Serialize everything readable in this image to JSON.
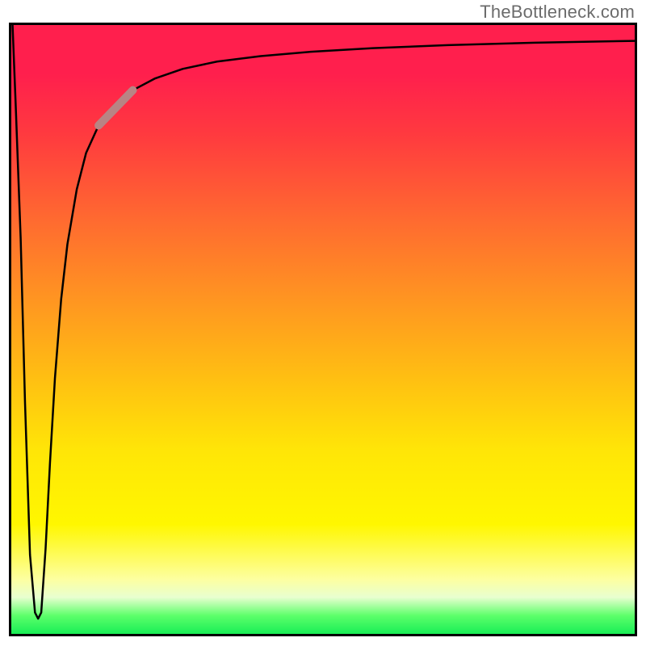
{
  "attribution": "TheBottleneck.com",
  "colors": {
    "border": "#000000",
    "curve": "#000000",
    "highlight": "#b88484",
    "gradient_top": "#ff1f4d",
    "gradient_bottom": "#19ee56"
  },
  "chart_data": {
    "type": "line",
    "title": "",
    "xlabel": "",
    "ylabel": "",
    "xlim": [
      0,
      100
    ],
    "ylim": [
      0,
      1.0
    ],
    "grid": false,
    "legend": false,
    "note": "Axes are unlabeled in the source image. x/y ranges are normalized (0–100, 0–1). Values are read off pixel positions.",
    "series": [
      {
        "name": "curve",
        "x": [
          0.2,
          0.7,
          1.5,
          2.2,
          3.0,
          3.8,
          4.3,
          4.8,
          5.5,
          6.2,
          7.0,
          8.0,
          9.0,
          10.5,
          12.0,
          14.0,
          16.5,
          19.5,
          23.0,
          27.5,
          33.0,
          40.0,
          48.0,
          58.0,
          70.0,
          84.0,
          100.0
        ],
        "y": [
          1.0,
          0.87,
          0.65,
          0.38,
          0.13,
          0.035,
          0.025,
          0.035,
          0.14,
          0.28,
          0.42,
          0.55,
          0.64,
          0.73,
          0.79,
          0.835,
          0.868,
          0.893,
          0.912,
          0.928,
          0.94,
          0.949,
          0.956,
          0.962,
          0.967,
          0.971,
          0.974
        ]
      }
    ],
    "highlight_segment": {
      "x": [
        14.0,
        19.5
      ],
      "y": [
        0.835,
        0.893
      ],
      "color": "#b88484"
    }
  }
}
